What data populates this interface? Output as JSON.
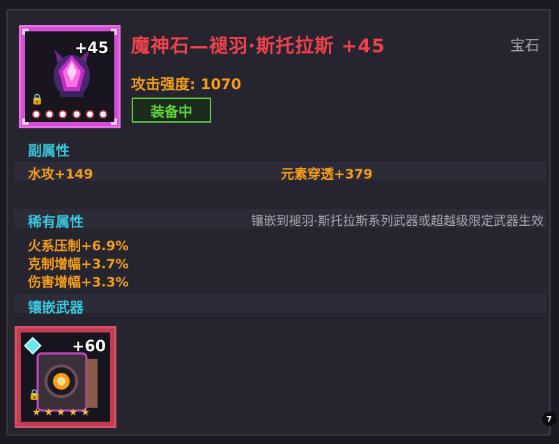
{
  "item": {
    "name": "魔神石—褪羽·斯托拉斯 +45",
    "level_badge": "+45",
    "category": "宝石",
    "attack": "攻击强度: 1070",
    "status": "装备中"
  },
  "secondary": {
    "heading": "副属性",
    "stats": [
      "水攻+149",
      "元素穿透+379"
    ]
  },
  "rare": {
    "heading": "稀有属性",
    "note": "镶嵌到褪羽·斯托拉斯系列武器或超越级限定武器生效",
    "stats": [
      "火系压制+6.9%",
      "克制增幅+3.7%",
      "伤害增幅+3.3%"
    ]
  },
  "inlay": {
    "heading": "镶嵌武器",
    "weapon_level": "+60",
    "weapon_stars": 5
  },
  "page_badge": "7",
  "colors": {
    "title": "#f2424b",
    "stat": "#f59e1c",
    "heading": "#39c8dc",
    "equipped": "#5fd33c"
  },
  "icons": {
    "item": "demon-gem-icon",
    "lock": "lock-icon",
    "socket": "socket-gem-icon",
    "weapon": "spellbook-weapon-icon"
  }
}
